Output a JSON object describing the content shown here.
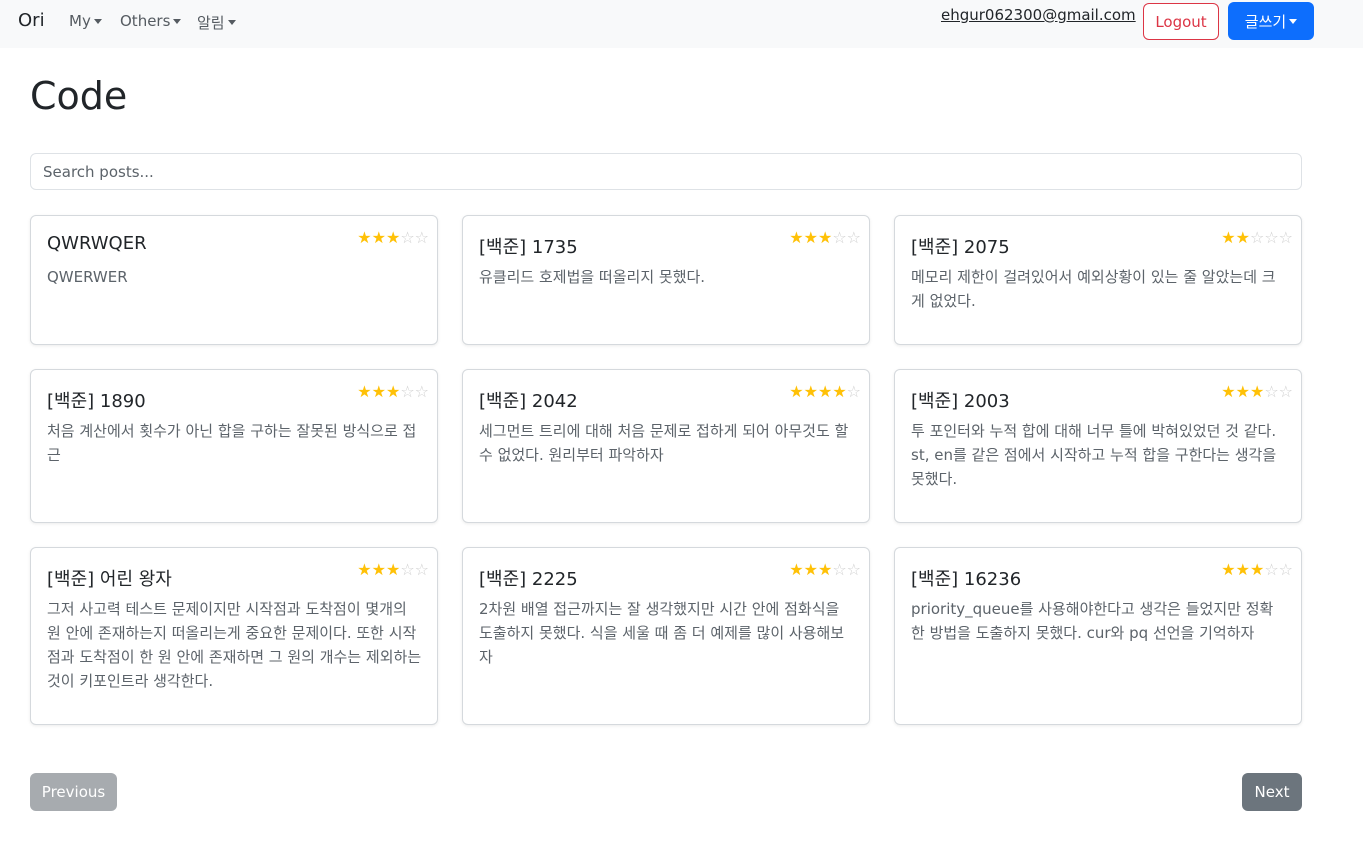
{
  "navbar": {
    "brand": "Ori",
    "menus": [
      "My",
      "Others",
      "알림"
    ],
    "email": "ehgur062300@gmail.com",
    "logout_label": "Logout",
    "write_label": "글쓰기",
    "colors": {
      "logout": "#dc3545",
      "write": "#0d6efd"
    }
  },
  "page": {
    "title": "Code",
    "search_placeholder": "Search posts..."
  },
  "posts": [
    {
      "title": "QWRWQER",
      "text": "QWERWER",
      "rating": 3,
      "max": 5
    },
    {
      "title": "[백준] 1735",
      "text": "유클리드 호제법을 떠올리지 못했다.",
      "rating": 3,
      "max": 5
    },
    {
      "title": "[백준] 2075",
      "text": "메모리 제한이 걸려있어서 예외상황이 있는 줄 알았는데 크게 없었다.",
      "rating": 2,
      "max": 5
    },
    {
      "title": "[백준] 1890",
      "text": "처음 계산에서 횟수가 아닌 합을 구하는 잘못된 방식으로 접근",
      "rating": 3,
      "max": 5
    },
    {
      "title": "[백준] 2042",
      "text": "세그먼트 트리에 대해 처음 문제로 접하게 되어 아무것도 할 수 없었다. 원리부터 파악하자",
      "rating": 4,
      "max": 5
    },
    {
      "title": "[백준] 2003",
      "text": "투 포인터와 누적 합에 대해 너무 틀에 박혀있었던 것 같다. st, en를 같은 점에서 시작하고 누적 합을 구한다는 생각을 못했다.",
      "rating": 3,
      "max": 5
    },
    {
      "title": "[백준] 어린 왕자",
      "text": "그저 사고력 테스트 문제이지만 시작점과 도착점이 몇개의 원 안에 존재하는지 떠올리는게 중요한 문제이다. 또한 시작점과 도착점이 한 원 안에 존재하면 그 원의 개수는 제외하는 것이 키포인트라 생각한다.",
      "rating": 3,
      "max": 5
    },
    {
      "title": "[백준] 2225",
      "text": "2차원 배열 접근까지는 잘 생각했지만 시간 안에 점화식을 도출하지 못했다. 식을 세울 때 좀 더 예제를 많이 사용해보자",
      "rating": 3,
      "max": 5
    },
    {
      "title": "[백준] 16236",
      "text": "priority_queue를 사용해야한다고 생각은 들었지만 정확한 방법을 도출하지 못했다. cur와 pq 선언을 기억하자",
      "rating": 3,
      "max": 5
    }
  ],
  "pagination": {
    "previous_label": "Previous",
    "next_label": "Next"
  }
}
